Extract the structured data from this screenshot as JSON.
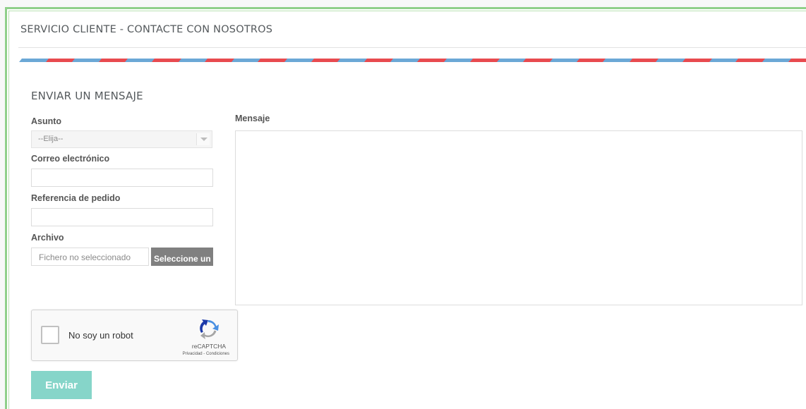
{
  "page": {
    "title": "SERVICIO CLIENTE - CONTACTE CON NOSOTROS"
  },
  "colors": {
    "frame_border": "#8fd08a",
    "stripe_red": "#e84a4f",
    "stripe_blue": "#6ba8d6",
    "submit_bg": "#86d5c9",
    "file_button_bg": "#808080"
  },
  "form": {
    "section_title": "ENVIAR UN MENSAJE",
    "subject": {
      "label": "Asunto",
      "value": "--Elija--"
    },
    "email": {
      "label": "Correo electrónico",
      "value": ""
    },
    "order_reference": {
      "label": "Referencia de pedido",
      "value": ""
    },
    "file": {
      "label": "Archivo",
      "status": "Fichero no seleccionado",
      "button_label": "Seleccione un"
    },
    "message": {
      "label": "Mensaje",
      "value": ""
    },
    "recaptcha": {
      "label": "No soy un robot",
      "brand": "reCAPTCHA",
      "links": "Privacidad - Condiciones",
      "checked": false
    },
    "submit_label": "Enviar"
  }
}
